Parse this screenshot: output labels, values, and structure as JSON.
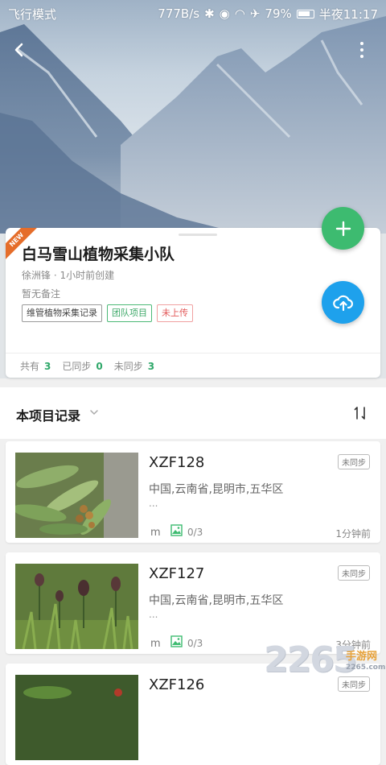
{
  "status_bar": {
    "left": "飞行模式",
    "speed": "777B/s",
    "battery": "79%",
    "time": "半夜11:17"
  },
  "project": {
    "new_badge": "NEW",
    "title": "白马雪山植物采集小队",
    "meta": "徐洲锋 · 1小时前创建",
    "note": "暂无备注",
    "tags": [
      "维管植物采集记录",
      "团队项目",
      "未上传"
    ],
    "stats": {
      "total_label": "共有",
      "total": "3",
      "synced_label": "已同步",
      "synced": "0",
      "unsynced_label": "未同步",
      "unsynced": "3"
    }
  },
  "section": {
    "title": "本项目记录",
    "sort_label": "1↓"
  },
  "records": [
    {
      "code": "XZF128",
      "location": "中国,云南省,昆明市,五华区",
      "ellipsis": "...",
      "unit": "m",
      "images": "0/3",
      "time": "1分钟前",
      "badge": "未同步"
    },
    {
      "code": "XZF127",
      "location": "中国,云南省,昆明市,五华区",
      "ellipsis": "...",
      "unit": "m",
      "images": "0/3",
      "time": "3分钟前",
      "badge": "未同步"
    },
    {
      "code": "XZF126",
      "badge": "未同步"
    }
  ],
  "watermark": {
    "number": "2265",
    "cn": "手游网",
    "url": "2265.com"
  },
  "colors": {
    "accent_green": "#3dbb70",
    "accent_blue": "#1ea1ec",
    "new_orange": "#e56d2a"
  }
}
